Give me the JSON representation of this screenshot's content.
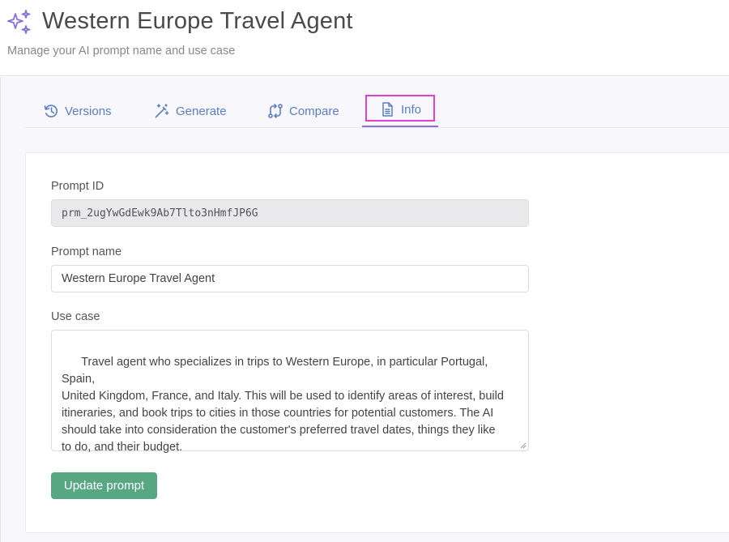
{
  "header": {
    "title": "Western Europe Travel Agent",
    "subtitle": "Manage your AI prompt name and use case",
    "icon": "sparkles-icon"
  },
  "tabs": [
    {
      "label": "Versions",
      "icon": "history-icon",
      "active": false
    },
    {
      "label": "Generate",
      "icon": "magic-wand-icon",
      "active": false
    },
    {
      "label": "Compare",
      "icon": "compare-icon",
      "active": false
    },
    {
      "label": "Info",
      "icon": "document-icon",
      "active": true
    }
  ],
  "form": {
    "prompt_id_label": "Prompt ID",
    "prompt_id_value": "prm_2ugYwGdEwk9Ab7Tlto3nHmfJP6G",
    "prompt_name_label": "Prompt name",
    "prompt_name_value": "Western Europe Travel Agent",
    "use_case_label": "Use case",
    "use_case_value": "Travel agent who specializes in trips to Western Europe, in particular Portugal, Spain,\nUnited Kingdom, France, and Italy. This will be used to identify areas of interest, build\nitineraries, and book trips to cities in those countries for potential customers. The AI\nshould take into consideration the customer's preferred travel dates, things they like\nto do, and their budget.",
    "submit_label": "Update prompt"
  },
  "colors": {
    "accent": "#8a6fd8",
    "tab_text": "#5a7ec2",
    "button": "#57a882",
    "highlight_box": "#e040d0"
  }
}
